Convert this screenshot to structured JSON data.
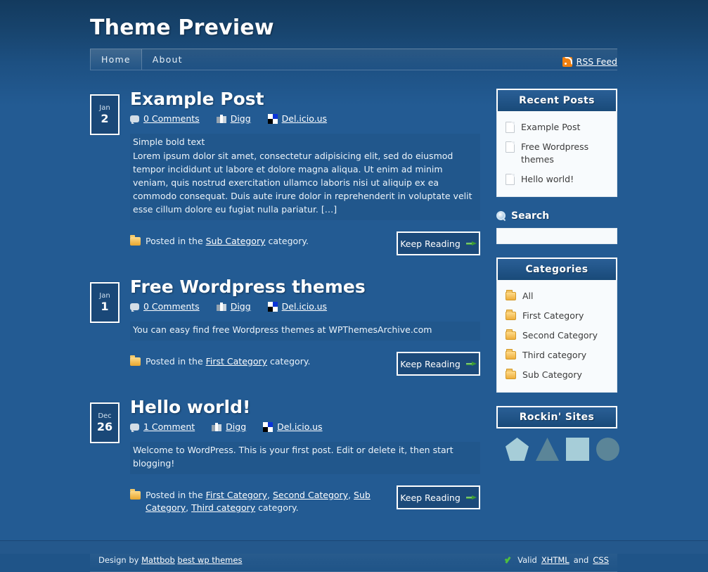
{
  "site": {
    "title": "Theme Preview",
    "nav": [
      {
        "label": "Home",
        "active": true
      },
      {
        "label": "About",
        "active": false
      }
    ],
    "rss": {
      "label": "RSS Feed",
      "icon": "rss-icon"
    }
  },
  "meta_labels": {
    "digg": "Digg",
    "delicious": "Del.icio.us",
    "keep_reading": "Keep Reading",
    "posted_prefix": "Posted in the",
    "posted_suffix": "category."
  },
  "posts": [
    {
      "month": "Jan",
      "day": "2",
      "title": "Example Post",
      "comments": "0 Comments",
      "digg": "Digg",
      "delicious": "Del.icio.us",
      "excerpt_bold": "Simple bold text",
      "excerpt": "Lorem ipsum dolor sit amet, consectetur adipisicing elit, sed do eiusmod tempor incididunt ut labore et dolore magna aliqua. Ut enim ad minim veniam, quis nostrud exercitation ullamco laboris nisi ut aliquip ex ea commodo consequat. Duis aute irure dolor in reprehenderit in voluptate velit esse cillum dolore eu fugiat nulla pariatur. […]",
      "categories": [
        "Sub Category"
      ],
      "keep_reading": "Keep Reading"
    },
    {
      "month": "Jan",
      "day": "1",
      "title": "Free Wordpress themes",
      "comments": "0 Comments",
      "digg": "Digg",
      "delicious": "Del.icio.us",
      "excerpt_bold": "",
      "excerpt": "You can easy find free Wordpress themes at WPThemesArchive.com",
      "categories": [
        "First Category"
      ],
      "keep_reading": "Keep Reading"
    },
    {
      "month": "Dec",
      "day": "26",
      "title": "Hello world!",
      "comments": "1 Comment",
      "digg": "Digg",
      "delicious": "Del.icio.us",
      "excerpt_bold": "",
      "excerpt": "Welcome to WordPress. This is your first post. Edit or delete it, then start blogging!",
      "categories": [
        "First Category",
        "Second Category",
        "Sub Category",
        "Third category"
      ],
      "keep_reading": "Keep Reading"
    }
  ],
  "sidebar": {
    "recent_posts": {
      "title": "Recent Posts",
      "items": [
        "Example Post",
        "Free Wordpress themes",
        "Hello world!"
      ]
    },
    "search": {
      "title": "Search",
      "icon": "magnifier-icon",
      "value": "",
      "placeholder": ""
    },
    "categories": {
      "title": "Categories",
      "items": [
        "All",
        "First Category",
        "Second Category",
        "Third category",
        "Sub Category"
      ]
    },
    "rockin_sites": {
      "title": "Rockin' Sites",
      "shapes": [
        "pentagon",
        "triangle",
        "square",
        "circle"
      ]
    }
  },
  "footer": {
    "design_by": "Design by",
    "author": "Mattbob",
    "author2": "best wp themes",
    "valid_text": "Valid",
    "xhtml": "XHTML",
    "and": "and",
    "css": "CSS"
  },
  "colors": {
    "page_bg": "#235b93",
    "header_bg": "#133a5e",
    "accent_white": "#ffffff",
    "widget_head": "#1d5084",
    "widget_body": "#f8fbfd",
    "folder": "#edae3c",
    "rss_orange": "#f08010",
    "arrow_green": "#3d9a36",
    "shape_light": "#a6cdd8",
    "shape_dark": "#5b8598"
  }
}
